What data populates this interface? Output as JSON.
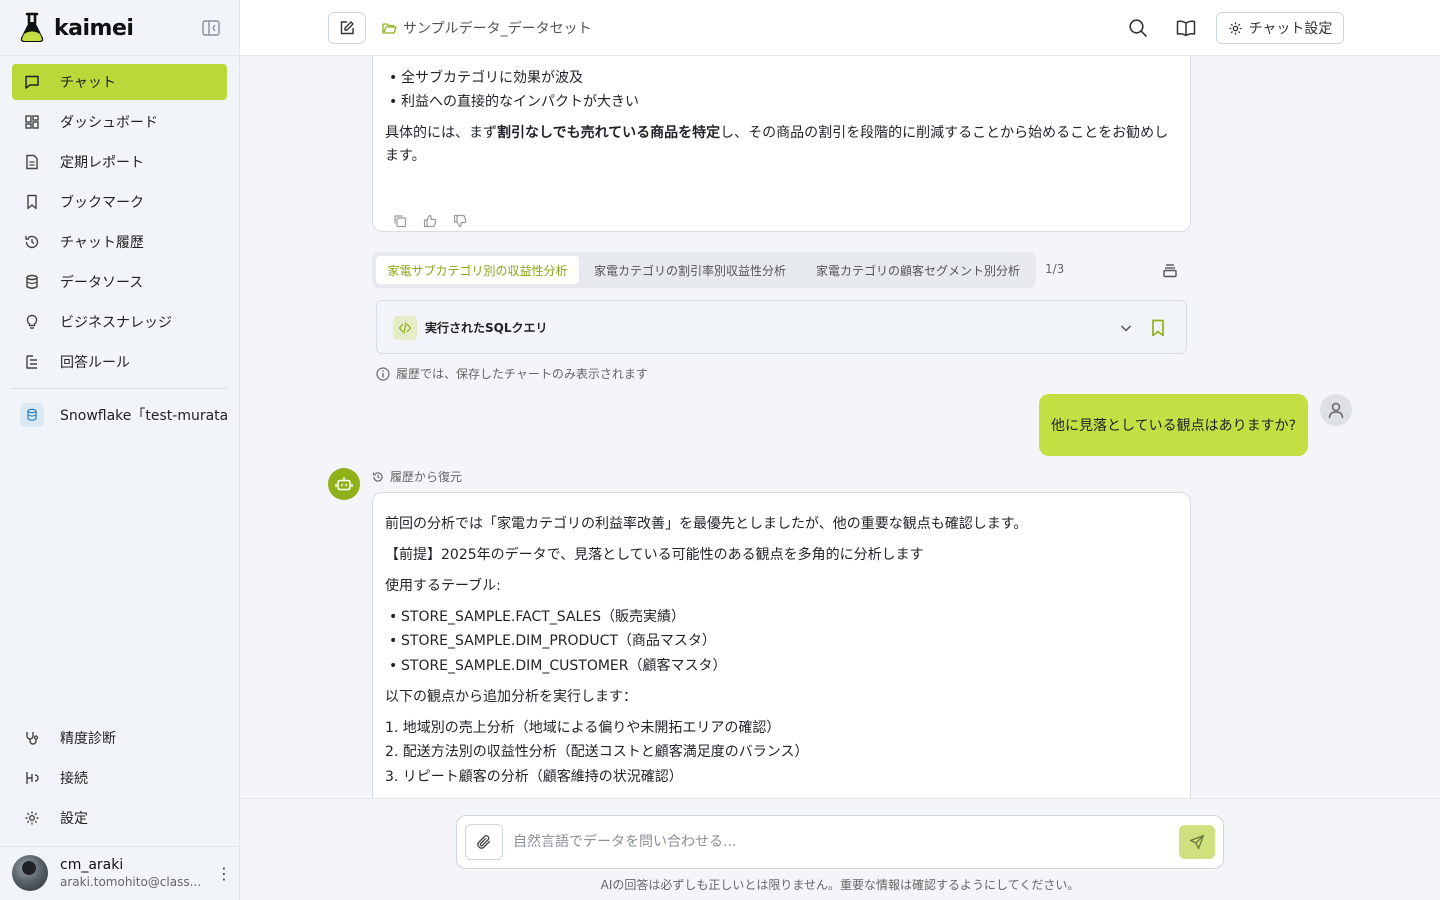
{
  "brand": {
    "name": "kaimei"
  },
  "sidebar": {
    "nav": [
      {
        "label": "チャット",
        "icon": "chat-icon",
        "active": true
      },
      {
        "label": "ダッシュボード",
        "icon": "dashboard-icon",
        "active": false
      },
      {
        "label": "定期レポート",
        "icon": "report-icon",
        "active": false
      },
      {
        "label": "ブックマーク",
        "icon": "bookmark-icon",
        "active": false
      },
      {
        "label": "チャット履歴",
        "icon": "history-icon",
        "active": false
      },
      {
        "label": "データソース",
        "icon": "database-icon",
        "active": false
      },
      {
        "label": "ビジネスナレッジ",
        "icon": "lightbulb-icon",
        "active": false
      },
      {
        "label": "回答ルール",
        "icon": "rules-icon",
        "active": false
      }
    ],
    "datasource": "Snowflake「test-murata」",
    "bottom_nav": [
      {
        "label": "精度診断",
        "icon": "stethoscope-icon"
      },
      {
        "label": "接続",
        "icon": "connection-icon"
      },
      {
        "label": "設定",
        "icon": "gear-icon"
      }
    ],
    "user": {
      "name": "cm_araki",
      "email": "araki.tomohito@class..."
    }
  },
  "header": {
    "dataset": "サンプルデータ_データセット",
    "settings_label": "チャット設定"
  },
  "message1": {
    "bullets": [
      "全サブカテゴリに効果が波及",
      "利益への直接的なインパクトが大きい"
    ],
    "para_pre": "具体的には、まず",
    "para_bold": "割引なしでも売れている商品を特定",
    "para_post": "し、その商品の割引を段階的に削減することから始めることをお勧めし",
    "para_line2": "ます。"
  },
  "tabs": {
    "items": [
      "家電サブカテゴリ別の収益性分析",
      "家電カテゴリの割引率別収益性分析",
      "家電カテゴリの顧客セグメント別分析"
    ],
    "count": "1/3"
  },
  "sql": {
    "label": "実行されたSQLクエリ"
  },
  "info_note": "履歴では、保存したチャートのみ表示されます",
  "user_message": "他に見落としている観点はありますか?",
  "message2": {
    "restore_label": "履歴から復元",
    "line1": "前回の分析では「家電カテゴリの利益率改善」を最優先としましたが、他の重要な観点も確認します。",
    "line2": "【前提】2025年のデータで、見落としている可能性のある観点を多角的に分析します",
    "line3": "使用するテーブル:",
    "tables": [
      "STORE_SAMPLE.FACT_SALES（販売実績）",
      "STORE_SAMPLE.DIM_PRODUCT（商品マスタ）",
      "STORE_SAMPLE.DIM_CUSTOMER（顧客マスタ）"
    ],
    "line4": "以下の観点から追加分析を実行します：",
    "points": [
      "1. 地域別の売上分析（地域による偏りや未開拓エリアの確認）",
      "2. 配送方法別の収益性分析（配送コストと顧客満足度のバランス）",
      "3. リピート顧客の分析（顧客維持の状況確認）"
    ]
  },
  "input": {
    "placeholder": "自然言語でデータを問い合わせる...",
    "disclaimer": "AIの回答は必ずしも正しいとは限りません。重要な情報は確認するようにしてください。"
  },
  "colors": {
    "accent": "#b9d93a",
    "user_bubble": "#c2df44",
    "bot_avatar": "#8fb21b"
  }
}
